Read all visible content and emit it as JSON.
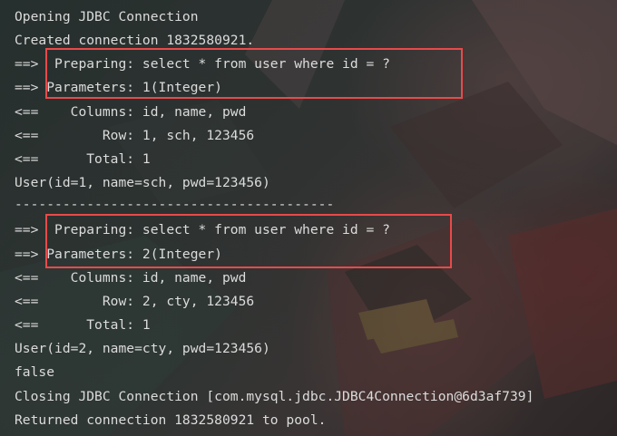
{
  "console": {
    "lines": [
      "Opening JDBC Connection",
      "Created connection 1832580921.",
      "==>  Preparing: select * from user where id = ?",
      "==> Parameters: 1(Integer)",
      "<==    Columns: id, name, pwd",
      "<==        Row: 1, sch, 123456",
      "<==      Total: 1",
      "User(id=1, name=sch, pwd=123456)",
      "----------------------------------------",
      "==>  Preparing: select * from user where id = ?",
      "==> Parameters: 2(Integer)",
      "<==    Columns: id, name, pwd",
      "<==        Row: 2, cty, 123456",
      "<==      Total: 1",
      "User(id=2, name=cty, pwd=123456)",
      "false",
      "Closing JDBC Connection [com.mysql.jdbc.JDBC4Connection@6d3af739]",
      "Returned connection 1832580921 to pool."
    ]
  },
  "colors": {
    "text": "#dcdcdc",
    "highlight_border": "#e84a4a",
    "background": "#2b2d30"
  }
}
